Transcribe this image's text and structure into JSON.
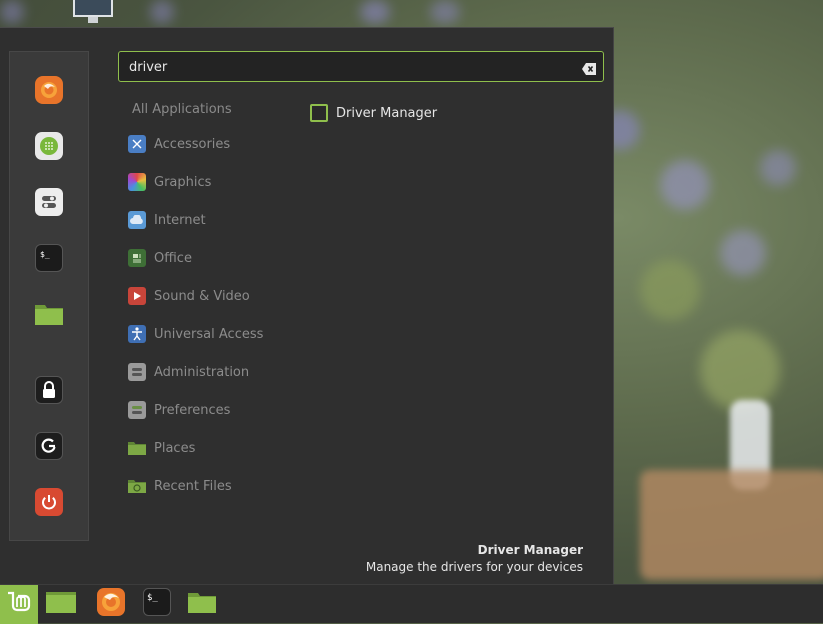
{
  "search": {
    "value": "driver",
    "placeholder": ""
  },
  "favorites": [
    {
      "icon": "firefox-icon"
    },
    {
      "icon": "software-manager-icon"
    },
    {
      "icon": "settings-icon"
    },
    {
      "icon": "terminal-icon"
    },
    {
      "icon": "files-icon"
    },
    {
      "icon": "lock-icon"
    },
    {
      "icon": "logout-icon"
    },
    {
      "icon": "power-icon"
    }
  ],
  "categories": {
    "all_label": "All Applications",
    "items": [
      {
        "label": "Accessories",
        "icon": "accessories-icon",
        "color": "#5a8fd6"
      },
      {
        "label": "Graphics",
        "icon": "graphics-icon",
        "color": "#c0506a"
      },
      {
        "label": "Internet",
        "icon": "internet-icon",
        "color": "#5a9ad6"
      },
      {
        "label": "Office",
        "icon": "office-icon",
        "color": "#4f8a43"
      },
      {
        "label": "Sound & Video",
        "icon": "sound-video-icon",
        "color": "#d0453a"
      },
      {
        "label": "Universal Access",
        "icon": "universal-access-icon",
        "color": "#4c7fc4"
      },
      {
        "label": "Administration",
        "icon": "administration-icon",
        "color": "#9a9a9a"
      },
      {
        "label": "Preferences",
        "icon": "preferences-icon",
        "color": "#9a9a9a"
      },
      {
        "label": "Places",
        "icon": "places-icon",
        "color": "#8fbf4c"
      },
      {
        "label": "Recent Files",
        "icon": "recent-files-icon",
        "color": "#8fbf4c"
      }
    ]
  },
  "results": [
    {
      "label": "Driver Manager",
      "icon": "driver-manager-icon"
    }
  ],
  "description": {
    "title": "Driver Manager",
    "text": "Manage the drivers for your devices"
  },
  "taskbar": [
    {
      "icon": "mint-menu-icon"
    },
    {
      "icon": "show-desktop-icon"
    },
    {
      "icon": "firefox-icon"
    },
    {
      "icon": "terminal-icon"
    },
    {
      "icon": "files-icon"
    }
  ],
  "colors": {
    "accent": "#8fbf4c",
    "menu_bg": "#2f2f2f",
    "panel_bg": "#2d2d2d"
  }
}
